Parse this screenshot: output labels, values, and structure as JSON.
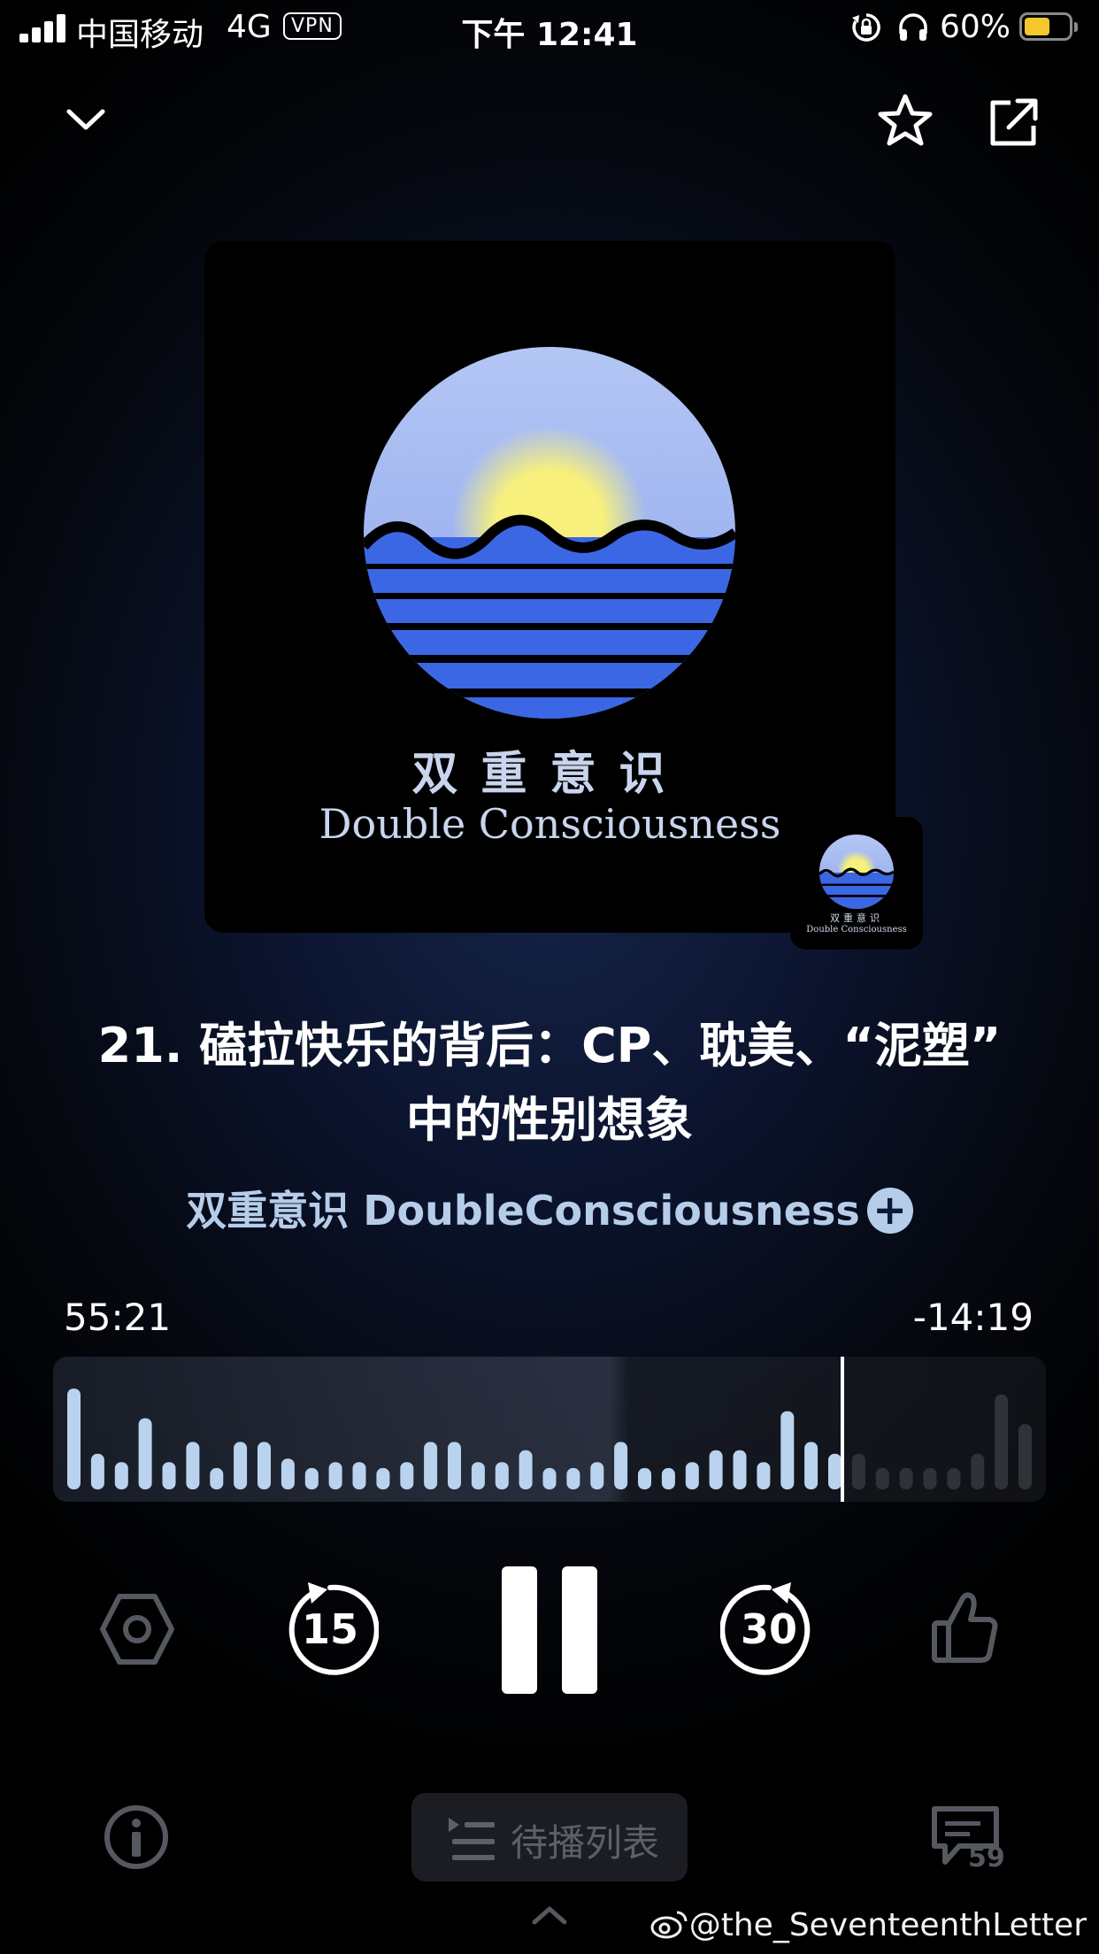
{
  "status_bar": {
    "carrier": "中国移动",
    "network": "4G",
    "vpn": "VPN",
    "time": "下午 12:41",
    "battery_percent": "60%",
    "battery_level": 0.6
  },
  "header": {
    "collapse_icon": "chevron-down-icon",
    "favorite_icon": "star-icon",
    "share_icon": "share-icon"
  },
  "artwork": {
    "title_cn": "双重意识",
    "title_en": "Double Consciousness",
    "colors": {
      "sky": "#a9bff2",
      "sun": "#f5ef7a",
      "sea": "#3e6ae6"
    }
  },
  "episode": {
    "title_line1": "21. 磕拉快乐的背后：CP、耽美、“泥塑”",
    "title_line2": "中的性别想象",
    "podcast": "双重意识 DoubleConsciousness",
    "follow_icon": "plus-icon"
  },
  "playback": {
    "elapsed": "55:21",
    "remaining": "-14:19",
    "progress": 0.795,
    "waveform_levels": [
      0.85,
      0.3,
      0.23,
      0.6,
      0.23,
      0.4,
      0.18,
      0.4,
      0.4,
      0.26,
      0.18,
      0.23,
      0.23,
      0.18,
      0.23,
      0.4,
      0.4,
      0.23,
      0.23,
      0.33,
      0.18,
      0.18,
      0.23,
      0.4,
      0.18,
      0.18,
      0.23,
      0.33,
      0.33,
      0.23,
      0.66,
      0.4,
      0.3,
      0.3,
      0.18,
      0.18,
      0.18,
      0.18,
      0.3,
      0.8,
      0.55
    ],
    "colors": {
      "played": "#b9d3ef",
      "unplayed": "#2f3238",
      "playhead": "#ffffff"
    }
  },
  "controls": {
    "speed_icon": "hexagon-speed-icon",
    "rewind_seconds": "15",
    "play_state": "pause",
    "forward_seconds": "30",
    "like_icon": "thumbs-up-icon"
  },
  "bottom_bar": {
    "info_icon": "info-icon",
    "queue_label": "待播列表",
    "queue_icon": "list-icon",
    "comment_icon": "comment-icon",
    "comment_count": "59",
    "expand_icon": "chevron-up-icon"
  },
  "watermark": "@the_SeventeenthLetter"
}
